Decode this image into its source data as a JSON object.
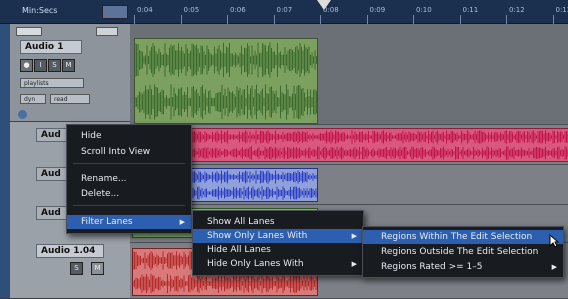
{
  "ruler": {
    "view_name": "Min:Secs",
    "ticks": [
      "0:04",
      "0:05",
      "0:06",
      "0:07",
      "0:08",
      "0:09",
      "0:10",
      "0:11",
      "0:12",
      "0:13"
    ]
  },
  "track1": {
    "name": "Audio 1",
    "buttons": [
      "●",
      "I",
      "S",
      "M"
    ],
    "playlist_label": "playlists",
    "mode_label": "dyn",
    "read_label": "read",
    "waveform_color": "#3b6b2e",
    "region_color": "#7ca05f"
  },
  "track2": {
    "name_partial": "Aud",
    "region_color": "#d8587f",
    "waveform_color": "#c0164a"
  },
  "track3": {
    "name_partial": "Aud",
    "region_color": "#8fa1d8",
    "waveform_color": "#2c3ec5"
  },
  "track4": {
    "name_partial": "Aud",
    "region_color": "#8fc27a",
    "waveform_color": "#3d7a2b"
  },
  "track5": {
    "name": "Audio 1.04",
    "buttons": [
      "S",
      "M"
    ],
    "region_color": "#d87a7a",
    "waveform_color": "#b52a2a"
  },
  "context_menu": {
    "items": [
      "Hide",
      "Scroll Into View",
      "Rename...",
      "Delete...",
      "Filter Lanes"
    ]
  },
  "filter_submenu": {
    "items": [
      "Show All Lanes",
      "Show Only Lanes With",
      "Hide All Lanes",
      "Hide Only Lanes With"
    ]
  },
  "regions_submenu": {
    "items": [
      "Regions Within The Edit Selection",
      "Regions Outside The Edit Selection",
      "Regions Rated >= 1–5"
    ]
  },
  "colors": {
    "menu_highlight": "#2d5fb0",
    "ruler_bg": "#1b2f4e"
  }
}
